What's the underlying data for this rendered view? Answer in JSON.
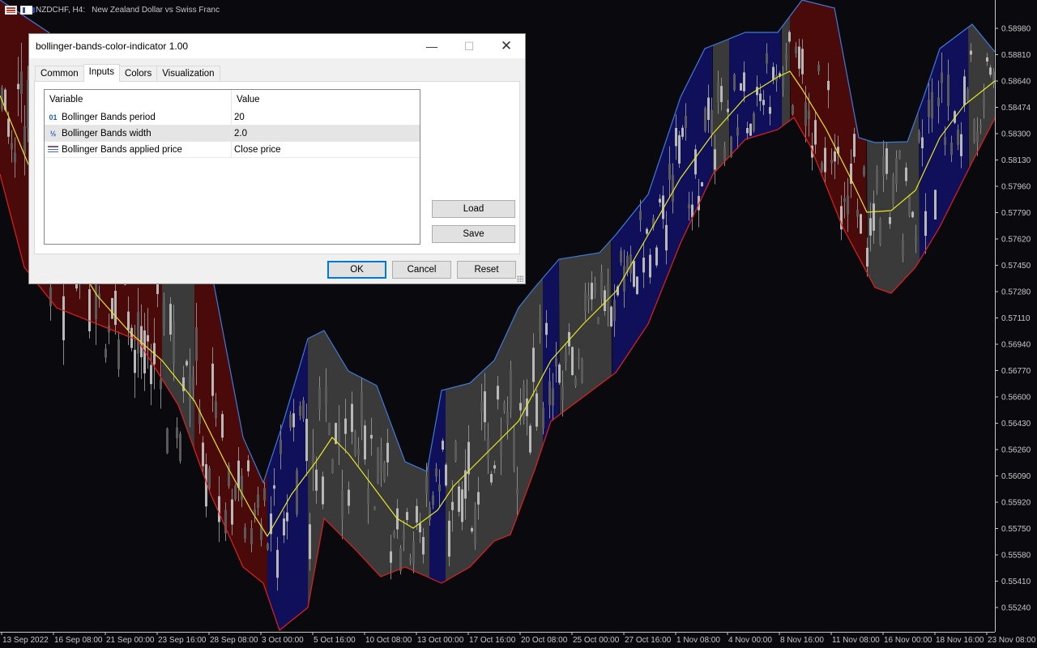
{
  "chart": {
    "symbol_label": "NZDCHF, H4:",
    "description": "New Zealand Dollar vs Swiss Franc",
    "price_labels": [
      "0.58980",
      "0.58810",
      "0.58640",
      "0.58474",
      "0.58300",
      "0.58130",
      "0.57960",
      "0.57790",
      "0.57620",
      "0.57450",
      "0.57280",
      "0.57110",
      "0.56940",
      "0.56770",
      "0.56600",
      "0.56430",
      "0.56260",
      "0.56090",
      "0.55920",
      "0.55750",
      "0.55580",
      "0.55410",
      "0.55240"
    ],
    "time_labels": [
      "13 Sep 2022",
      "16 Sep 08:00",
      "21 Sep 00:00",
      "23 Sep 16:00",
      "28 Sep 08:00",
      "3 Oct 00:00",
      "5 Oct 16:00",
      "10 Oct 08:00",
      "13 Oct 00:00",
      "17 Oct 16:00",
      "20 Oct 08:00",
      "25 Oct 00:00",
      "27 Oct 16:00",
      "1 Nov 08:00",
      "4 Nov 00:00",
      "8 Nov 16:00",
      "11 Nov 08:00",
      "16 Nov 00:00",
      "18 Nov 16:00",
      "23 Nov 08:00"
    ],
    "colors": {
      "background": "#0a0a0e",
      "upper_band": "#3d7bd8",
      "lower_band": "#e02020",
      "middle_line": "#e8e820",
      "fill_up": "#10105a",
      "fill_down": "#4a0a0a",
      "fill_flat": "#3a3a3a",
      "candles": "#9a9a9a",
      "axis_text": "#c8c8c8"
    }
  },
  "dialog": {
    "title": "bollinger-bands-color-indicator 1.00",
    "controls": {
      "minimize": "—",
      "maximize": "☐",
      "close": "✕"
    },
    "tabs": [
      {
        "label": "Common",
        "active": false
      },
      {
        "label": "Inputs",
        "active": true
      },
      {
        "label": "Colors",
        "active": false
      },
      {
        "label": "Visualization",
        "active": false
      }
    ],
    "grid": {
      "headers": {
        "variable": "Variable",
        "value": "Value"
      },
      "rows": [
        {
          "icon": "01",
          "variable": "Bollinger Bands period",
          "value": "20"
        },
        {
          "icon": "½",
          "variable": "Bollinger Bands width",
          "value": "2.0"
        },
        {
          "icon": "",
          "variable": "Bollinger Bands applied price",
          "value": "Close price"
        }
      ]
    },
    "buttons": {
      "load": "Load",
      "save": "Save",
      "ok": "OK",
      "cancel": "Cancel",
      "reset": "Reset"
    }
  }
}
